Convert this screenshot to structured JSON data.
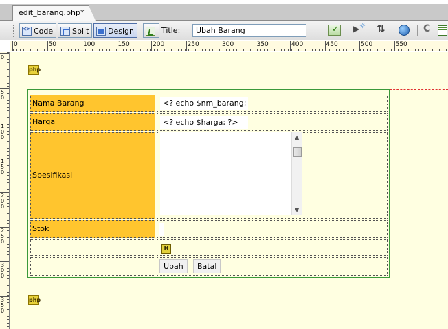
{
  "tab": {
    "filename": "edit_barang.php*"
  },
  "toolbar": {
    "code_label": "Code",
    "split_label": "Split",
    "design_label": "Design",
    "title_label": "Title:",
    "title_value": "Ubah Barang"
  },
  "ruler": {
    "h_numbers": [
      "0",
      "50",
      "100",
      "150",
      "200",
      "250",
      "300",
      "350",
      "400",
      "450",
      "500",
      "550"
    ],
    "v_numbers": [
      "0",
      "50",
      "100",
      "150",
      "200",
      "250",
      "300",
      "350"
    ]
  },
  "canvas": {
    "php_badge_top": "php",
    "php_badge_bottom": "php",
    "hidden_field_marker": "H"
  },
  "form": {
    "rows": [
      {
        "label": "Nama Barang",
        "value": "<? echo $nm_barang; ?"
      },
      {
        "label": "Harga",
        "value": "<? echo $harga; ?>"
      },
      {
        "label": "Spesifikasi",
        "value": ""
      },
      {
        "label": "Stok",
        "value": ""
      }
    ],
    "buttons": {
      "submit": "Ubah",
      "cancel": "Batal"
    }
  },
  "colors": {
    "canvas_bg": "#ffffe1",
    "label_bg": "#ffc52e",
    "form_border": "#3a9a3a",
    "margin_guide": "#e03030"
  },
  "icons": [
    "code-view-icon",
    "split-view-icon",
    "design-view-icon",
    "live-view-icon",
    "validate-icon",
    "preview-icon",
    "file-transfer-icon",
    "browser-check-icon",
    "refresh-icon",
    "visual-aids-icon",
    "php-tag-icon",
    "hidden-field-icon"
  ]
}
